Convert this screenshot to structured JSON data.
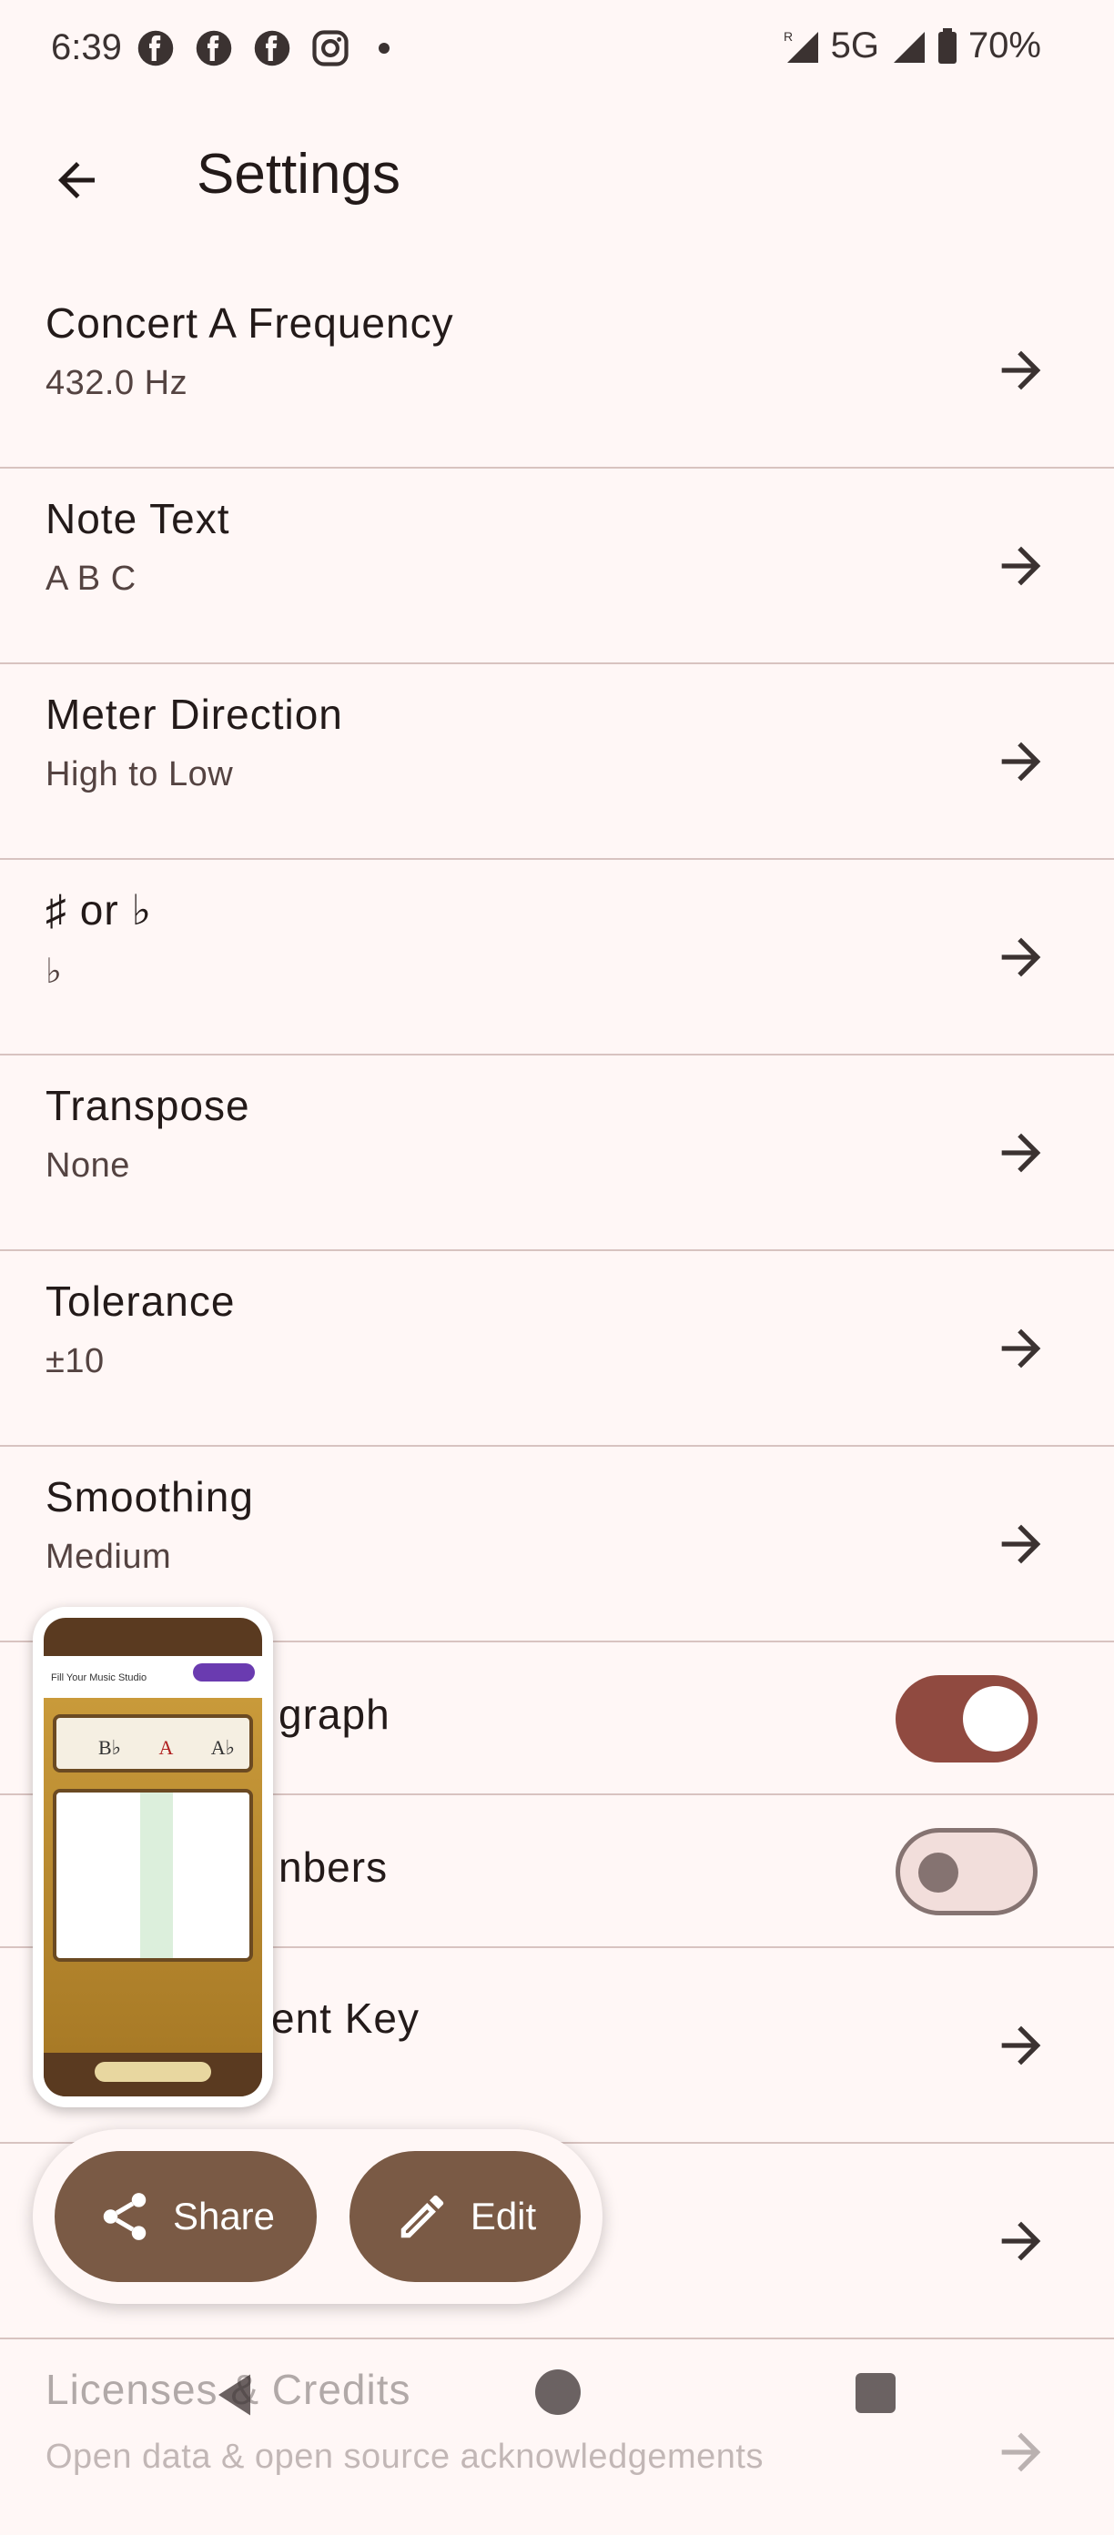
{
  "status_bar": {
    "time": "6:39",
    "network": "5G",
    "roaming": "R",
    "battery": "70%",
    "icons": [
      "facebook-icon",
      "facebook-icon",
      "facebook-icon",
      "instagram-icon"
    ]
  },
  "app_bar": {
    "title": "Settings"
  },
  "settings": [
    {
      "title": "Concert A Frequency",
      "subtitle": "432.0 Hz"
    },
    {
      "title": "Note Text",
      "subtitle": "A B C"
    },
    {
      "title": "Meter Direction",
      "subtitle": "High to Low"
    },
    {
      "title": "♯ or ♭",
      "subtitle": "♭"
    },
    {
      "title": "Transpose",
      "subtitle": "None"
    },
    {
      "title": "Tolerance",
      "subtitle": "±10"
    },
    {
      "title": "Smoothing",
      "subtitle": "Medium"
    }
  ],
  "partial_rows": {
    "graph_label": "graph",
    "numbers_label": "nbers",
    "key_label": "ent Key",
    "licenses_title": "Licenses & Credits",
    "licenses_subtitle": "Open data & open source acknowledgements"
  },
  "toggles": {
    "graph_on": true,
    "numbers_on": false
  },
  "thumbnail": {
    "ad_text": "Fill Your Music Studio",
    "notes": [
      "B♭",
      "A",
      "A♭"
    ]
  },
  "actions": {
    "share_label": "Share",
    "edit_label": "Edit"
  },
  "colors": {
    "background": "#fff7f6",
    "accent": "#904a40",
    "button": "#7a5a45"
  }
}
